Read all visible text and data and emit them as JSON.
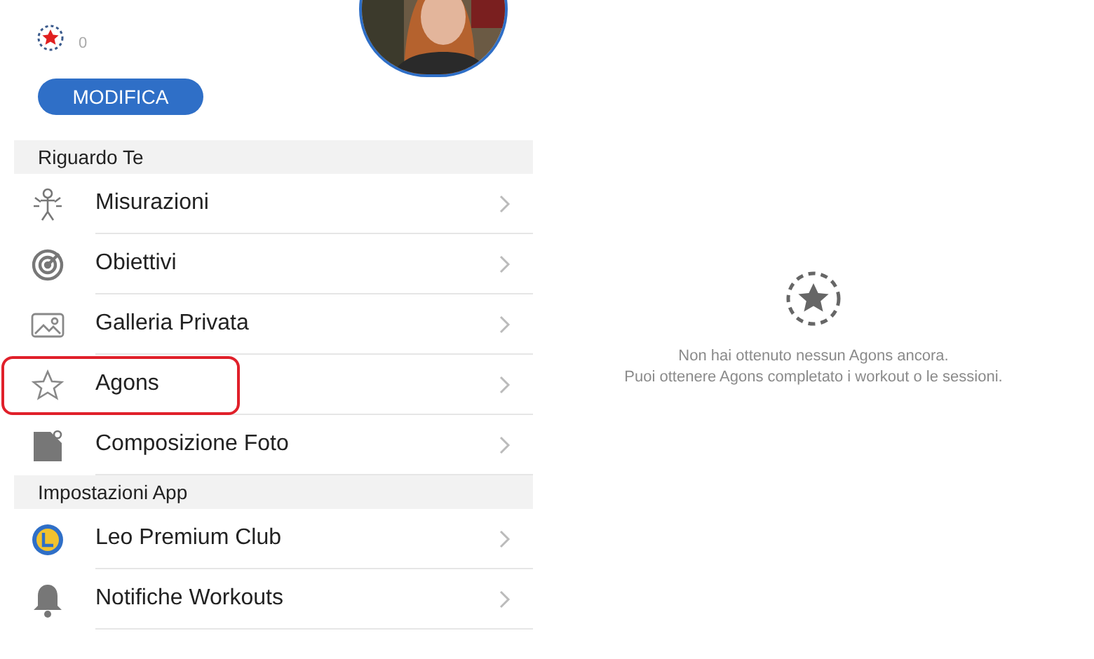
{
  "profile": {
    "agons_count": "0",
    "edit_button": "MODIFICA"
  },
  "sections": [
    {
      "title": "Riguardo Te",
      "items": [
        {
          "label": "Misurazioni",
          "highlighted": false
        },
        {
          "label": "Obiettivi",
          "highlighted": false
        },
        {
          "label": "Galleria Privata",
          "highlighted": false
        },
        {
          "label": "Agons",
          "highlighted": true
        },
        {
          "label": "Composizione Foto",
          "highlighted": false
        }
      ]
    },
    {
      "title": "Impostazioni App",
      "items": [
        {
          "label": "Leo Premium Club",
          "highlighted": false
        },
        {
          "label": "Notifiche Workouts",
          "highlighted": false
        }
      ]
    }
  ],
  "empty_state": {
    "lines": [
      "Non hai ottenuto nessun Agons ancora.",
      "Puoi ottenere Agons completato i workout o le sessioni."
    ]
  }
}
